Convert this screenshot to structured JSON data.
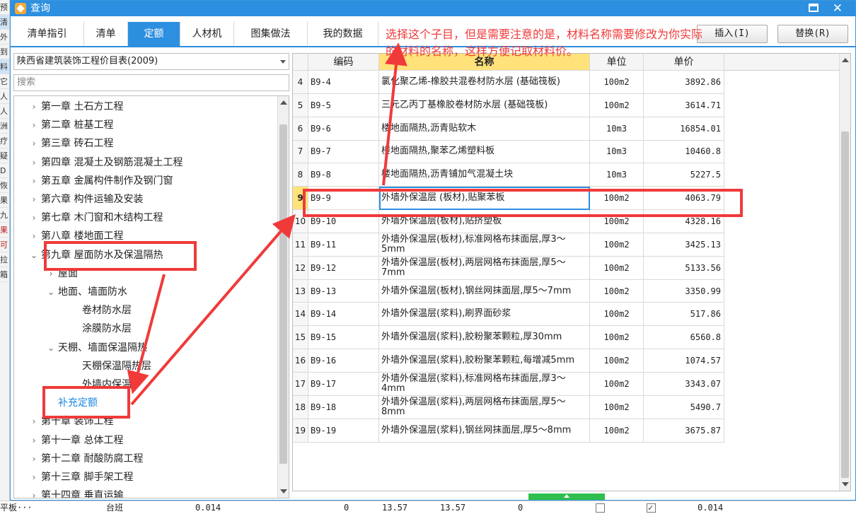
{
  "window": {
    "title": "查询"
  },
  "background_left": [
    "预",
    "清",
    "外",
    "到",
    "料",
    "它",
    "人",
    "人",
    "洲",
    "疗",
    "疑",
    "D",
    "恢",
    "果",
    "九",
    "果",
    "可",
    "拉",
    "箱"
  ],
  "tabs": [
    {
      "label": "清单指引",
      "active": false
    },
    {
      "label": "清单",
      "active": false
    },
    {
      "label": "定额",
      "active": true
    },
    {
      "label": "人材机",
      "active": false
    },
    {
      "label": "图集做法",
      "active": false
    },
    {
      "label": "我的数据",
      "active": false
    }
  ],
  "buttons": {
    "insert": "插入(I)",
    "replace": "替换(R)"
  },
  "library_select": "陕西省建筑装饰工程价目表(2009)",
  "search_placeholder": "搜索",
  "tree": [
    {
      "label": "第一章 土石方工程",
      "level": 0,
      "toggle": "›"
    },
    {
      "label": "第二章 桩基工程",
      "level": 0,
      "toggle": "›"
    },
    {
      "label": "第三章 砖石工程",
      "level": 0,
      "toggle": "›"
    },
    {
      "label": "第四章 混凝土及钢筋混凝土工程",
      "level": 0,
      "toggle": "›"
    },
    {
      "label": "第五章 金属构件制作及钢门窗",
      "level": 0,
      "toggle": "›"
    },
    {
      "label": "第六章 构件运输及安装",
      "level": 0,
      "toggle": "›"
    },
    {
      "label": "第七章 木门窗和木结构工程",
      "level": 0,
      "toggle": "›"
    },
    {
      "label": "第八章 楼地面工程",
      "level": 0,
      "toggle": "›"
    },
    {
      "label": "第九章 屋面防水及保温隔热",
      "level": 0,
      "toggle": "⌄"
    },
    {
      "label": "屋面",
      "level": 1,
      "toggle": "›"
    },
    {
      "label": "地面、墙面防水",
      "level": 1,
      "toggle": "⌄"
    },
    {
      "label": "卷材防水层",
      "level": 2,
      "toggle": ""
    },
    {
      "label": "涂膜防水层",
      "level": 2,
      "toggle": ""
    },
    {
      "label": "天棚、墙面保温隔热",
      "level": 1,
      "toggle": "⌄"
    },
    {
      "label": "天棚保温隔热层",
      "level": 2,
      "toggle": ""
    },
    {
      "label": "外墙内保温",
      "level": 2,
      "toggle": ""
    },
    {
      "label": "补充定额",
      "level": 1,
      "toggle": "",
      "link": true
    },
    {
      "label": "第十章 装饰工程",
      "level": 0,
      "toggle": "›"
    },
    {
      "label": "第十一章 总体工程",
      "level": 0,
      "toggle": "›"
    },
    {
      "label": "第十二章 耐酸防腐工程",
      "level": 0,
      "toggle": "›"
    },
    {
      "label": "第十三章 脚手架工程",
      "level": 0,
      "toggle": "›"
    },
    {
      "label": "第十四章 垂直运输",
      "level": 0,
      "toggle": "›"
    }
  ],
  "grid": {
    "headers": [
      "",
      "编码",
      "名称",
      "单位",
      "单价"
    ],
    "rows": [
      {
        "num": "4",
        "code": "B9-4",
        "name": "氯化聚乙烯-橡胶共混卷材防水层 (基础筏板)",
        "unit": "100m2",
        "price": "3892.86"
      },
      {
        "num": "5",
        "code": "B9-5",
        "name": "三元乙丙丁基橡胶卷材防水层 (基础筏板)",
        "unit": "100m2",
        "price": "3614.71"
      },
      {
        "num": "6",
        "code": "B9-6",
        "name": "楼地面隔热,沥青贴软木",
        "unit": "10m3",
        "price": "16854.01"
      },
      {
        "num": "7",
        "code": "B9-7",
        "name": "楼地面隔热,聚苯乙烯塑料板",
        "unit": "10m3",
        "price": "10460.8"
      },
      {
        "num": "8",
        "code": "B9-8",
        "name": "楼地面隔热,沥青铺加气混凝土块",
        "unit": "10m3",
        "price": "5227.5"
      },
      {
        "num": "9",
        "code": "B9-9",
        "name": "外墙外保温层 (板材),贴聚苯板",
        "unit": "100m2",
        "price": "4063.79",
        "selected": true
      },
      {
        "num": "10",
        "code": "B9-10",
        "name": "外墙外保温层(板材),贴挤塑板",
        "unit": "100m2",
        "price": "4328.16"
      },
      {
        "num": "11",
        "code": "B9-11",
        "name": "外墙外保温层(板材),标准网格布抹面层,厚3～5mm",
        "unit": "100m2",
        "price": "3425.13"
      },
      {
        "num": "12",
        "code": "B9-12",
        "name": "外墙外保温层(板材),两层网格布抹面层,厚5～7mm",
        "unit": "100m2",
        "price": "5133.56"
      },
      {
        "num": "13",
        "code": "B9-13",
        "name": "外墙外保温层(板材),钢丝网抹面层,厚5～7mm",
        "unit": "100m2",
        "price": "3350.99"
      },
      {
        "num": "14",
        "code": "B9-14",
        "name": "外墙外保温层(浆料),刷界面砂浆",
        "unit": "100m2",
        "price": "517.86"
      },
      {
        "num": "15",
        "code": "B9-15",
        "name": "外墙外保温层(浆料),胶粉聚苯颗粒,厚30mm",
        "unit": "100m2",
        "price": "6560.8"
      },
      {
        "num": "16",
        "code": "B9-16",
        "name": "外墙外保温层(浆料),胶粉聚苯颗粒,每增减5mm",
        "unit": "100m2",
        "price": "1074.57"
      },
      {
        "num": "17",
        "code": "B9-17",
        "name": "外墙外保温层(浆料),标准网格布抹面层,厚3～4mm",
        "unit": "100m2",
        "price": "3343.07"
      },
      {
        "num": "18",
        "code": "B9-18",
        "name": "外墙外保温层(浆料),两层网格布抹面层,厚5～8mm",
        "unit": "100m2",
        "price": "5490.7"
      },
      {
        "num": "19",
        "code": "B9-19",
        "name": "外墙外保温层(浆料),钢丝网抹面层,厚5～8mm",
        "unit": "100m2",
        "price": "3675.87"
      }
    ]
  },
  "annotation": "选择这个子目，但是需要注意的是，材料名称需要修改为你实际的材料的名称，这样方便记取材料价。",
  "bottom_bar": {
    "name": "平板···",
    "unit": "台班",
    "qty": "0.014",
    "zero": "0",
    "p1": "13.57",
    "p2": "13.57",
    "zero2": "0",
    "total": "0.014"
  },
  "colors": {
    "accent": "#2d8fdf",
    "annotation": "#f03a3a",
    "selected_header": "#ffe27a",
    "link": "#1a87e0"
  }
}
